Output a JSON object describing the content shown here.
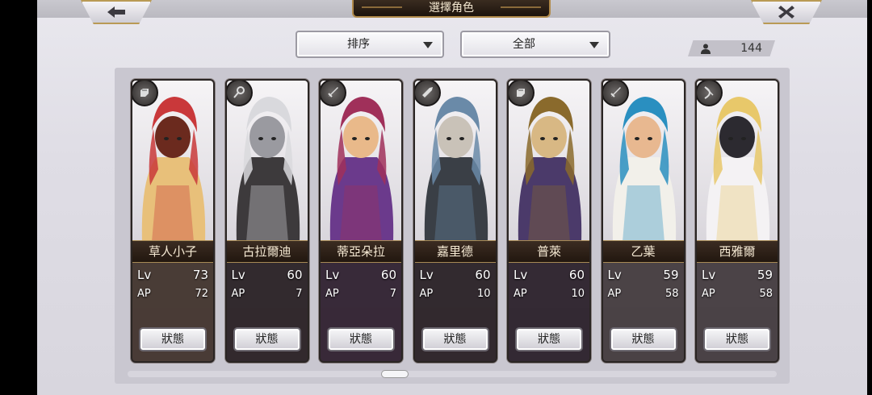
{
  "header": {
    "title": "選擇角色",
    "back_icon": "back-arrow-icon",
    "close_icon": "close-x-icon"
  },
  "filters": {
    "sort_label": "排序",
    "category_label": "全部"
  },
  "roster": {
    "count": "144",
    "icon": "person-icon"
  },
  "status_label": "狀態",
  "colors": {
    "accent_gold": "#b08a4a",
    "nameplate": "#2c1f16",
    "panel": "#c9c7d0"
  },
  "characters": [
    {
      "name": "草人小子",
      "lv_label": "Lv",
      "lv": "73",
      "ap_label": "AP",
      "ap": "72",
      "class_icon": "gauntlet-class-icon",
      "palette": [
        "#c9383a",
        "#e8c07a",
        "#6b2a1e"
      ]
    },
    {
      "name": "古拉爾迪",
      "lv_label": "Lv",
      "lv": "60",
      "ap_label": "AP",
      "ap": "7",
      "class_icon": "key-class-icon",
      "palette": [
        "#d9d9dd",
        "#3d3a3c",
        "#9a9aa0"
      ]
    },
    {
      "name": "蒂亞朵拉",
      "lv_label": "Lv",
      "lv": "60",
      "ap_label": "AP",
      "ap": "7",
      "class_icon": "sword-class-icon",
      "palette": [
        "#a0305a",
        "#6b3a8c",
        "#e9b98a"
      ]
    },
    {
      "name": "嘉里德",
      "lv_label": "Lv",
      "lv": "60",
      "ap_label": "AP",
      "ap": "10",
      "class_icon": "lance-class-icon",
      "palette": [
        "#6a8aa8",
        "#3a3f46",
        "#c9c2b8"
      ]
    },
    {
      "name": "普萊",
      "lv_label": "Lv",
      "lv": "60",
      "ap_label": "AP",
      "ap": "10",
      "class_icon": "gauntlet-class-icon",
      "palette": [
        "#8a6a2c",
        "#4b3a6a",
        "#d8b884"
      ]
    },
    {
      "name": "乙葉",
      "lv_label": "Lv",
      "lv": "59",
      "ap_label": "AP",
      "ap": "58",
      "class_icon": "sword-class-icon",
      "palette": [
        "#2a8fc0",
        "#f2f0ea",
        "#e8b890"
      ]
    },
    {
      "name": "西雅爾",
      "lv_label": "Lv",
      "lv": "59",
      "ap_label": "AP",
      "ap": "58",
      "class_icon": "bow-class-icon",
      "palette": [
        "#e8c86a",
        "#f4f2f4",
        "#2c2a30"
      ]
    }
  ]
}
